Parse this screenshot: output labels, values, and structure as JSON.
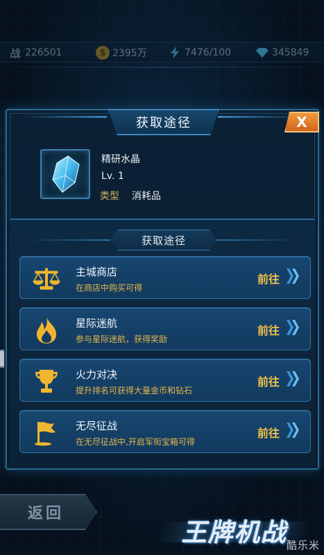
{
  "topbar": {
    "power": {
      "icon": "power-glyph",
      "value": "226501"
    },
    "gold": {
      "icon": "gold-coin-icon",
      "value": "2395万"
    },
    "energy": {
      "icon": "lightning-icon",
      "value": "7476/100"
    },
    "diamond": {
      "icon": "diamond-icon",
      "value": "345849"
    }
  },
  "dialog": {
    "title": "获取途径",
    "close_label": "X",
    "item": {
      "name": "精研水晶",
      "level": "Lv. 1",
      "type_label": "类型",
      "type_value": "消耗品",
      "icon": "crystal-icon"
    },
    "panel_title": "获取途径",
    "sources": [
      {
        "icon": "scales-icon",
        "title": "主城商店",
        "desc": "在商店中购买可得",
        "go": "前往"
      },
      {
        "icon": "flame-icon",
        "title": "星际迷航",
        "desc": "参与星际迷航，获得奖励",
        "go": "前往"
      },
      {
        "icon": "trophy-icon",
        "title": "火力对决",
        "desc": "提升排名可获得大量金币和钻石",
        "go": "前往"
      },
      {
        "icon": "flag-icon",
        "title": "无尽征战",
        "desc": "在无尽征战中,开启军衔宝箱可得",
        "go": "前往"
      }
    ]
  },
  "bottom": {
    "back_label": "返回",
    "logo_text": "王牌机战",
    "watermark": "酷乐米"
  },
  "colors": {
    "accent_gold": "#f2c24a",
    "desc_gold": "#e5b64a",
    "close_orange": "#e07a28",
    "frame_blue": "#2f6790"
  }
}
